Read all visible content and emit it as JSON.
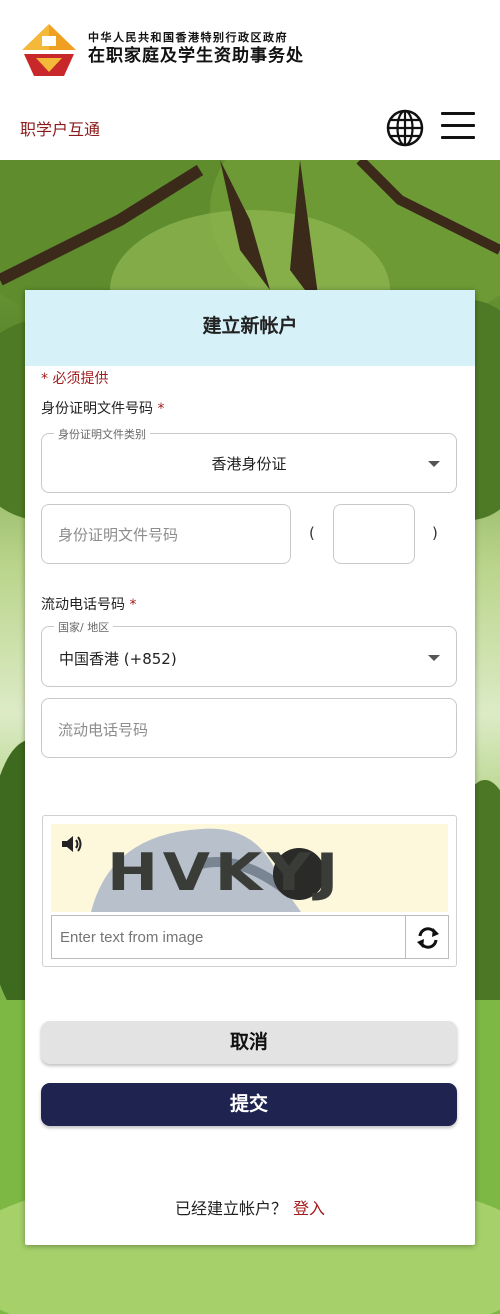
{
  "header": {
    "org_line1": "中华人民共和国香港特别行政区政府",
    "org_line2": "在职家庭及学生资助事务处",
    "nav_link": "职学户互通"
  },
  "form": {
    "title": "建立新帐户",
    "required_note": "* 必须提供",
    "id_section": {
      "label": "身份证明文件号码",
      "required_mark": "*",
      "doc_type_legend": "身份证明文件类别",
      "doc_type_value": "香港身份证",
      "id_number_placeholder": "身份证明文件号码",
      "paren_open": "(",
      "paren_close": ")"
    },
    "phone_section": {
      "label": "流动电话号码",
      "required_mark": "*",
      "country_legend": "国家/ 地区",
      "country_value": "中国香港 (+852)",
      "phone_placeholder": "流动电话号码"
    },
    "captcha": {
      "image_text": "HVKYJ",
      "input_placeholder": "Enter text from image"
    },
    "cancel_label": "取消",
    "submit_label": "提交",
    "footer_text": "已经建立帐户？",
    "login_label": "登入"
  },
  "colors": {
    "accent_red": "#a01c1c",
    "header_bg": "#d6f1f8",
    "submit_bg": "#1e2350",
    "logo_orange": "#f0a020",
    "logo_red": "#c8282a"
  }
}
